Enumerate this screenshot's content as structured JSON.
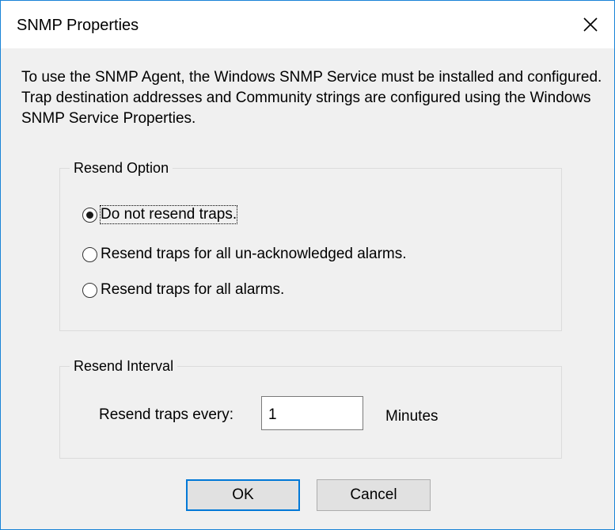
{
  "dialog": {
    "title": "SNMP Properties",
    "intro": "To use the SNMP Agent, the Windows SNMP Service must be installed and configured. Trap destination addresses and Community strings are configured using the Windows SNMP Service Properties."
  },
  "resend_option": {
    "legend": "Resend Option",
    "options": [
      {
        "label": "Do not resend traps.",
        "checked": true
      },
      {
        "label": "Resend traps for all un-acknowledged alarms.",
        "checked": false
      },
      {
        "label": "Resend traps for all alarms.",
        "checked": false
      }
    ]
  },
  "resend_interval": {
    "legend": "Resend Interval",
    "label": "Resend traps every:",
    "value": "1",
    "unit": "Minutes"
  },
  "buttons": {
    "ok": "OK",
    "cancel": "Cancel"
  },
  "colors": {
    "window_border": "#1883d7",
    "default_button_border": "#0078d7"
  },
  "icons": {
    "close": "close-icon"
  }
}
